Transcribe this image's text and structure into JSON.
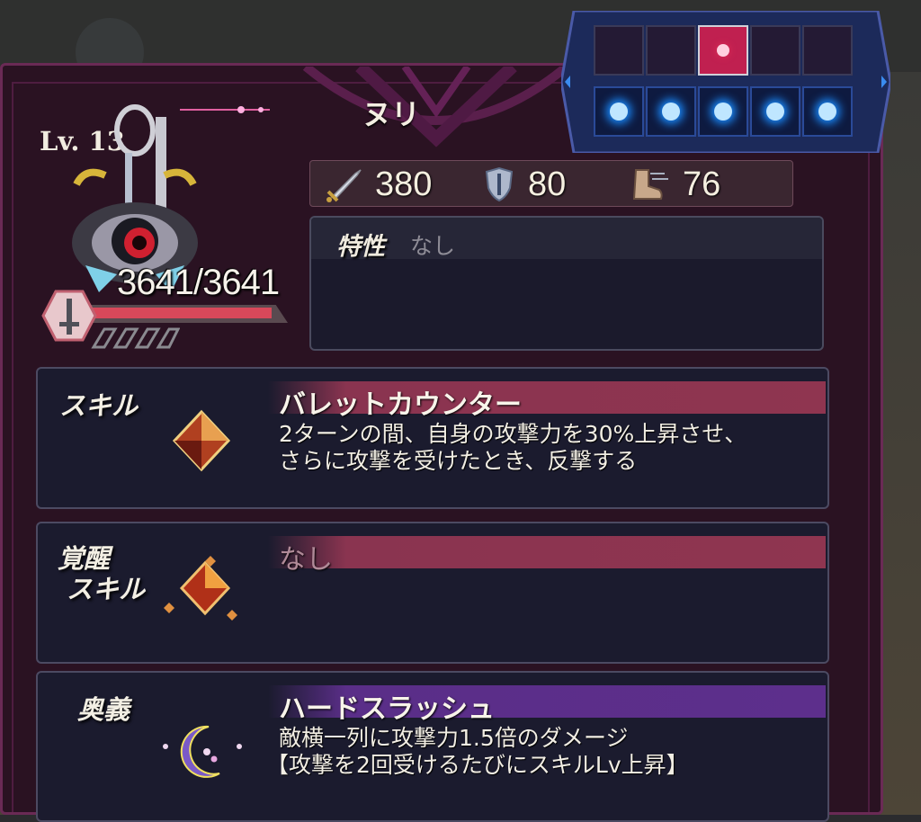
{
  "unit": {
    "name": "ヌリ",
    "level": "Lv. 13",
    "hp_text": "3641/3641",
    "hp_fraction": 1.0
  },
  "stats": {
    "attack": "380",
    "defense": "80",
    "speed": "76"
  },
  "trait": {
    "label": "特性",
    "value": "なし"
  },
  "skill": {
    "label": "スキル",
    "title": "バレットカウンター",
    "desc_line1": "2ターンの間、自身の攻撃力を30%上昇させ、",
    "desc_line2": "さらに攻撃を受けたとき、反撃する"
  },
  "awaken_skill": {
    "label_line1": "覚醒",
    "label_line2": "スキル",
    "title": "なし"
  },
  "ultimate": {
    "label": "奥義",
    "title": "ハードスラッシュ",
    "desc_line1": "敵横一列に攻撃力1.5倍のダメージ",
    "desc_line2": "【攻撃を2回受けるたびにスキルLv上昇】"
  },
  "formation": {
    "top_row": [
      false,
      false,
      true,
      false,
      false
    ],
    "bottom_row": [
      true,
      true,
      true,
      true,
      true
    ],
    "colors": {
      "enemy": "#e0305a",
      "ally": "#1a8cff"
    }
  },
  "colors": {
    "panel": "#2a1222",
    "skill_bar": "#8f3550",
    "ultimate_bar": "#5d2f8c",
    "hp_fill": "#d8485a"
  },
  "icons": [
    "sword-icon",
    "shield-icon",
    "boot-icon",
    "weapon-hex-icon",
    "skill-gem-icon",
    "awaken-gem-icon",
    "moon-orb-icon"
  ]
}
